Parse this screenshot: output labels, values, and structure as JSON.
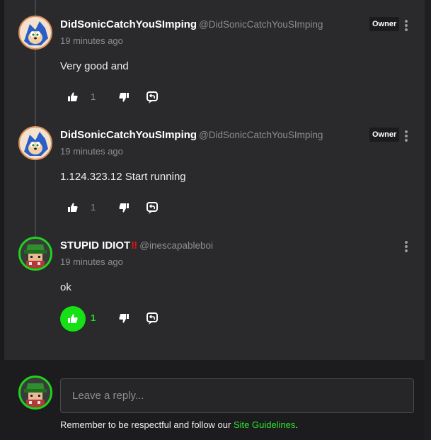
{
  "comments": [
    {
      "username": "DidSonicCatchYouSImping",
      "handle": "@DidSonicCatchYouSImping",
      "time": "19 minutes ago",
      "badge": "Owner",
      "text": "Very good and",
      "likes": "1",
      "liked": false,
      "avatar": "sonic-avatar"
    },
    {
      "username": "DidSonicCatchYouSImping",
      "handle": "@DidSonicCatchYouSImping",
      "time": "19 minutes ago",
      "badge": "Owner",
      "text": "1.124.323.12 Start running",
      "likes": "1",
      "liked": false,
      "avatar": "sonic-avatar"
    },
    {
      "username": "STUPID IDIOT",
      "username_suffix": "‼",
      "handle": "@inescapableboi",
      "time": "19 minutes ago",
      "text": "ok",
      "likes": "1",
      "liked": true,
      "avatar": "green-hat-avatar"
    }
  ],
  "reply": {
    "placeholder": "Leave a reply...",
    "notice_prefix": "Remember to be respectful and follow our ",
    "notice_link": "Site Guidelines",
    "notice_suffix": "."
  },
  "colors": {
    "accent": "#16e016",
    "background": "#2a292b",
    "owner_badge": "#1b1a1c"
  }
}
